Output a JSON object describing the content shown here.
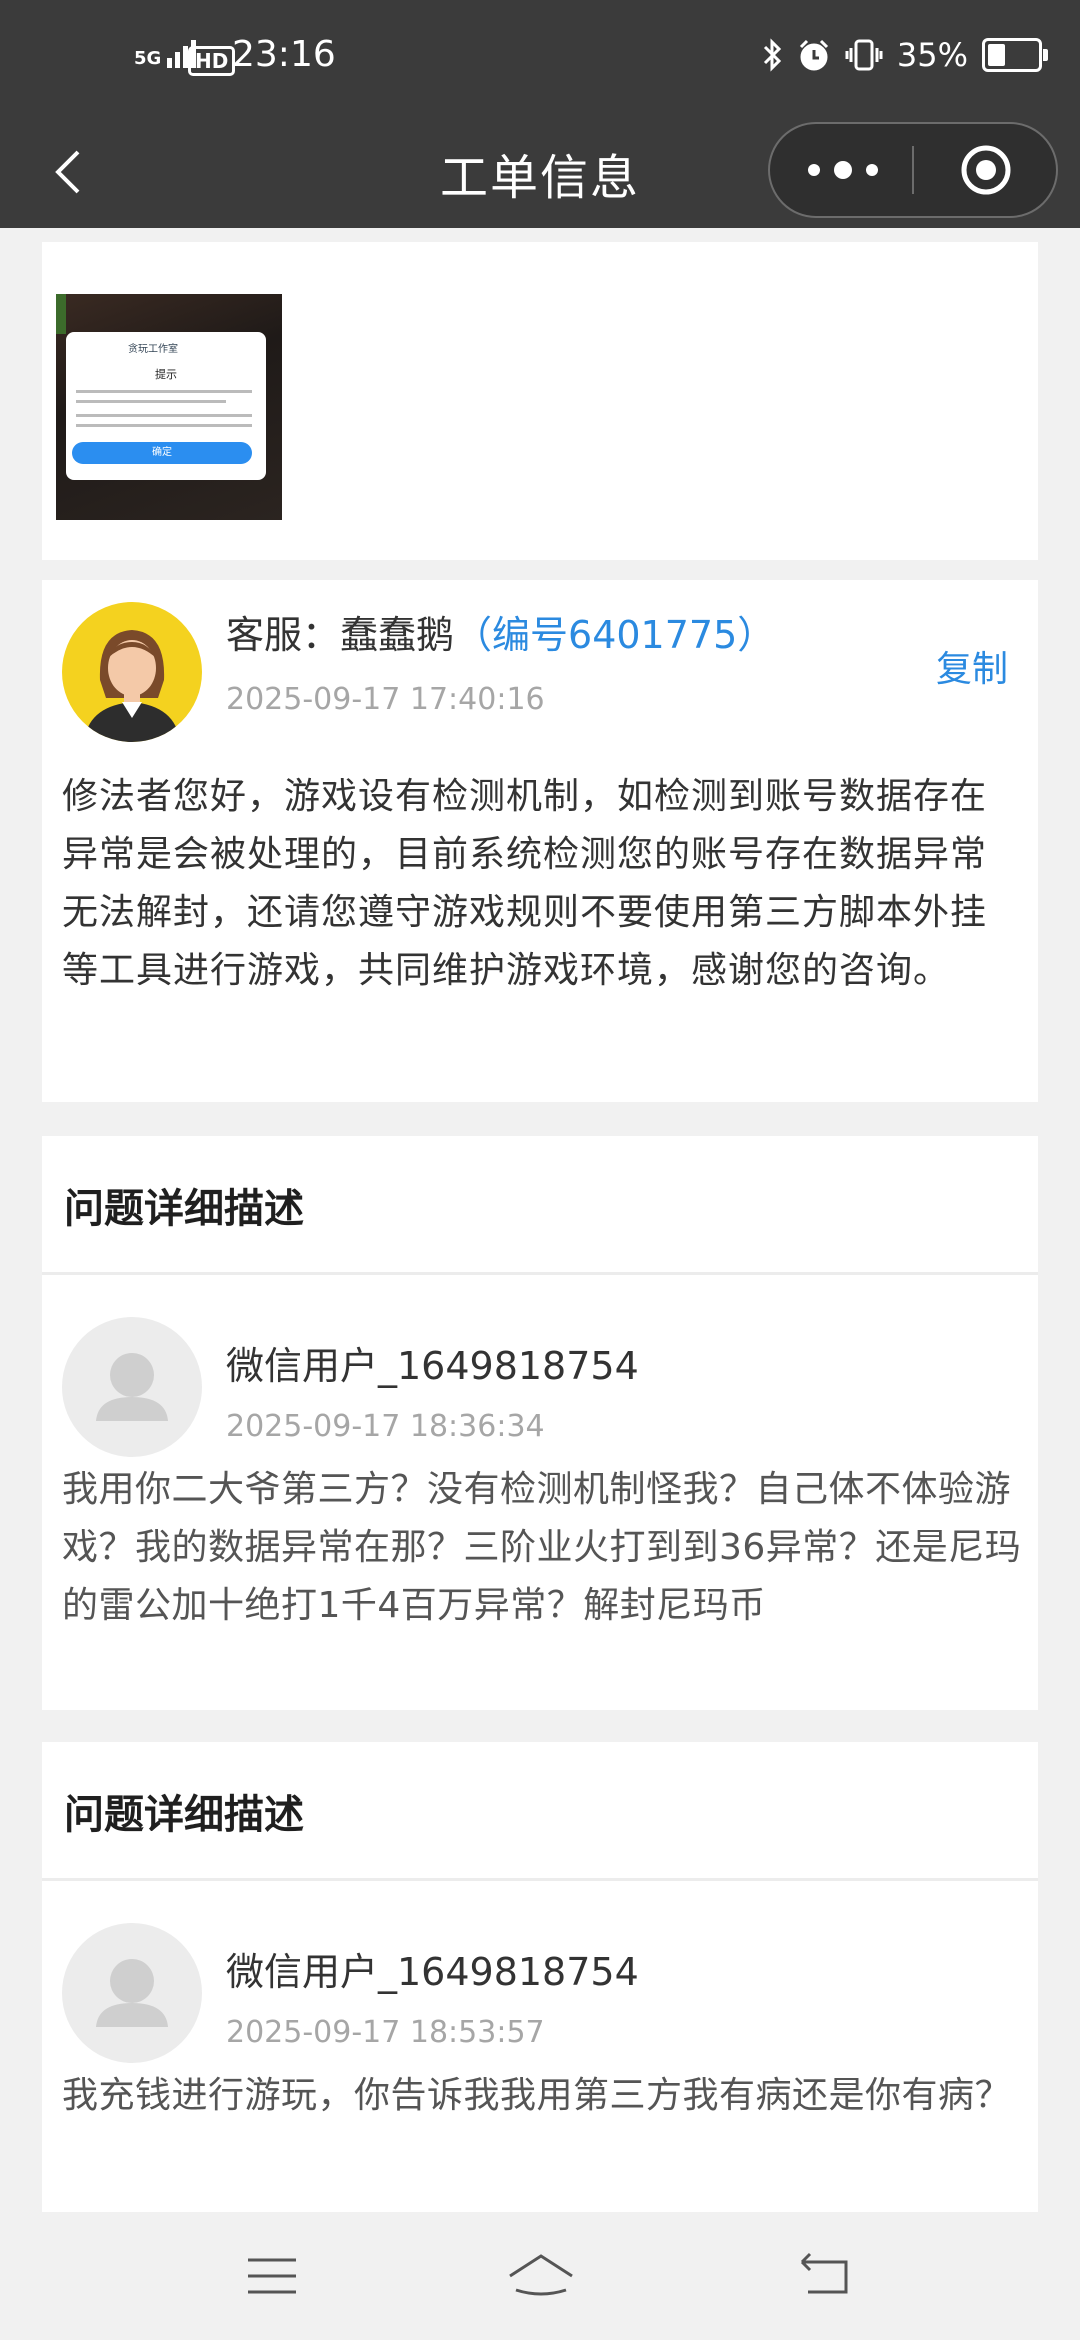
{
  "status_bar": {
    "network": "5G",
    "hd_label": "HD",
    "time": "23:16",
    "battery_percent": "35%",
    "battery_level": 0.35,
    "icons": [
      "bluetooth-icon",
      "alarm-icon",
      "vibrate-icon",
      "battery-icon"
    ]
  },
  "nav": {
    "title": "工单信息",
    "icons": [
      "back-arrow-icon",
      "more-dots-icon",
      "target-icon"
    ]
  },
  "attachment": {
    "thumbnail_title": "提示",
    "thumbnail_button": "确定",
    "thumbnail_logo": "贪玩工作室"
  },
  "reply": {
    "agent_prefix": "客服：蠢蠢鹅",
    "agent_id": "（编号6401775）",
    "time": "2025-09-17 17:40:16",
    "copy_label": "复制",
    "text": "修法者您好，游戏设有检测机制，如检测到账号数据存在异常是会被处理的，目前系统检测您的账号存在数据异常无法解封，还请您遵守游戏规则不要使用第三方脚本外挂等工具进行游戏，共同维护游戏环境，感谢您的咨询。"
  },
  "sections": [
    {
      "header": "问题详细描述",
      "user": "微信用户_1649818754",
      "time": "2025-09-17 18:36:34",
      "text": "我用你二大爷第三方？没有检测机制怪我？自己体不体验游戏？我的数据异常在那？三阶业火打到到36异常？还是尼玛的雷公加十绝打1千4百万异常？解封尼玛币"
    },
    {
      "header": "问题详细描述",
      "user": "微信用户_1649818754",
      "time": "2025-09-17 18:53:57",
      "text": "我充钱进行游玩，你告诉我我用第三方我有病还是你有病？"
    }
  ],
  "bottom_nav": {
    "icons": [
      "menu-icon",
      "home-icon",
      "back-icon"
    ]
  }
}
